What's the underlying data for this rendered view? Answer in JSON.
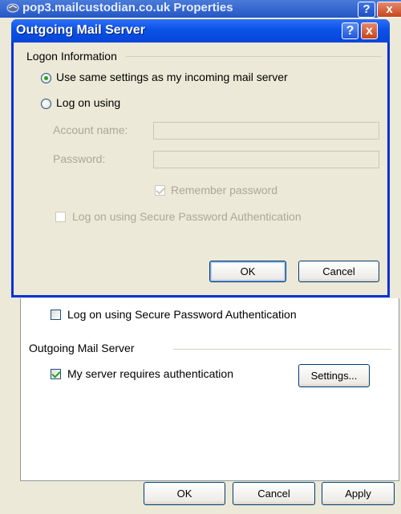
{
  "background_window": {
    "title": "pop3.mailcustodian.co.uk Properties",
    "help_glyph": "?",
    "close_glyph": "x",
    "spa_checkbox": {
      "label": "Log on using Secure Password Authentication",
      "checked": false
    },
    "outgoing_group": {
      "title": "Outgoing Mail Server"
    },
    "requires_auth_checkbox": {
      "label": "My server requires authentication",
      "checked": true
    },
    "settings_button": "Settings...",
    "buttons": {
      "ok": "OK",
      "cancel": "Cancel",
      "apply": "Apply"
    }
  },
  "dialog": {
    "title": "Outgoing Mail Server",
    "help_glyph": "?",
    "close_glyph": "x",
    "group_title": "Logon Information",
    "radio_same": {
      "label": "Use same settings as my incoming mail server",
      "selected": true
    },
    "radio_logon": {
      "label": "Log on using",
      "selected": false
    },
    "account_name": {
      "label": "Account name:",
      "value": ""
    },
    "password": {
      "label": "Password:",
      "value": ""
    },
    "remember_password": {
      "label": "Remember password",
      "checked": true,
      "enabled": false
    },
    "spa_checkbox": {
      "label": "Log on using Secure Password Authentication",
      "checked": false,
      "enabled": false
    },
    "buttons": {
      "ok": "OK",
      "cancel": "Cancel"
    }
  },
  "colors": {
    "title_bar_blue": "#0a52e8",
    "dialog_face": "#ece9d8",
    "check_green": "#21a121",
    "disabled_text": "#aca899"
  },
  "icons": {
    "title_icon": "mail-account-icon"
  }
}
